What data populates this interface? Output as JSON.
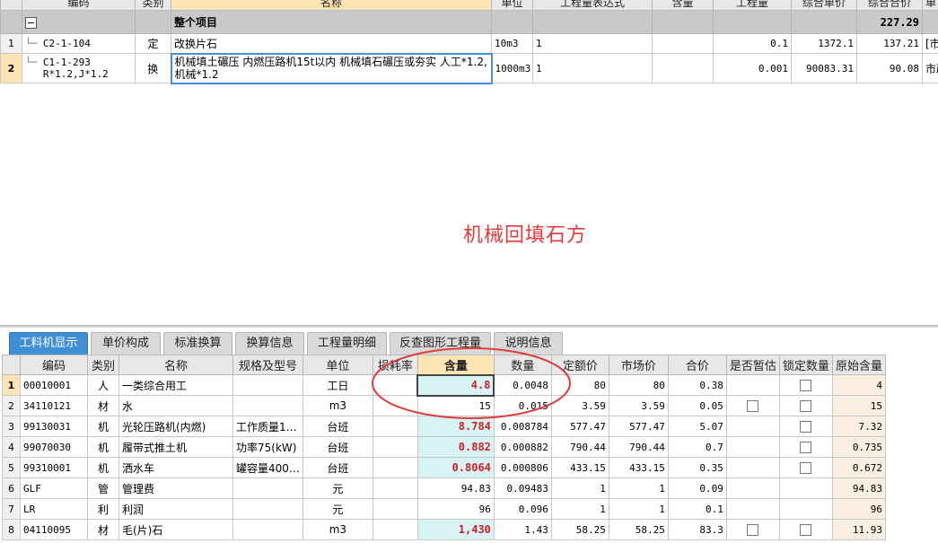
{
  "top_grid": {
    "columns": [
      "编码",
      "类别",
      "名称",
      "单位",
      "工程量表达式",
      "含量",
      "工程量",
      "综合单价",
      "综合合价",
      "单"
    ],
    "group_row": {
      "label": "整个项目",
      "total": "227.29"
    },
    "rows": [
      {
        "rn": "1",
        "code": "C2-1-104",
        "code2": "",
        "cat": "定",
        "name": "改换片石",
        "unit": "10m3",
        "expr": "1",
        "content": "",
        "qty": "0.1",
        "unit_price": "1372.1",
        "total": "137.21",
        "extra": "[市"
      },
      {
        "rn": "2",
        "code": "C1-1-293",
        "code2": "R*1.2,J*1.2",
        "cat": "换",
        "name": "机械填土碾压 内燃压路机15t以内  机械填石碾压或夯实 人工*1.2,机械*1.2",
        "unit": "1000m3",
        "expr": "1",
        "content": "",
        "qty": "0.001",
        "unit_price": "90083.31",
        "total": "90.08",
        "extra": "市政"
      }
    ]
  },
  "overlay_note": "机械回填石方",
  "tabs": [
    "工料机显示",
    "单价构成",
    "标准换算",
    "换算信息",
    "工程量明细",
    "反查图形工程量",
    "说明信息"
  ],
  "bottom_grid": {
    "columns": [
      "",
      "编码",
      "类别",
      "名称",
      "规格及型号",
      "单位",
      "损耗率",
      "含量",
      "数量",
      "定额价",
      "市场价",
      "合价",
      "是否暂估",
      "锁定数量",
      "原始含量"
    ],
    "rows": [
      {
        "rn": "1",
        "code": "00010001",
        "cat": "人",
        "name": "一类综合用工",
        "spec": "",
        "unit": "工日",
        "loss": "",
        "content": "4.8",
        "amount": "0.0048",
        "quota_price": "80",
        "market_price": "80",
        "total": "0.38",
        "provisional": false,
        "lock": true,
        "orig": "4"
      },
      {
        "rn": "2",
        "code": "34110121",
        "cat": "材",
        "name": "水",
        "spec": "",
        "unit": "m3",
        "loss": "",
        "content": "15",
        "amount": "0.015",
        "quota_price": "3.59",
        "market_price": "3.59",
        "total": "0.05",
        "provisional": true,
        "lock": true,
        "orig": "15"
      },
      {
        "rn": "3",
        "code": "99130031",
        "cat": "机",
        "name": "光轮压路机(内燃)",
        "spec": "工作质量1…",
        "unit": "台班",
        "loss": "",
        "content": "8.784",
        "amount": "0.008784",
        "quota_price": "577.47",
        "market_price": "577.47",
        "total": "5.07",
        "provisional": false,
        "lock": true,
        "orig": "7.32"
      },
      {
        "rn": "4",
        "code": "99070030",
        "cat": "机",
        "name": "履带式推土机",
        "spec": "功率75(kW)",
        "unit": "台班",
        "loss": "",
        "content": "0.882",
        "amount": "0.000882",
        "quota_price": "790.44",
        "market_price": "790.44",
        "total": "0.7",
        "provisional": false,
        "lock": true,
        "orig": "0.735"
      },
      {
        "rn": "5",
        "code": "99310001",
        "cat": "机",
        "name": "洒水车",
        "spec": "罐容量400…",
        "unit": "台班",
        "loss": "",
        "content": "0.8064",
        "amount": "0.000806",
        "quota_price": "433.15",
        "market_price": "433.15",
        "total": "0.35",
        "provisional": false,
        "lock": true,
        "orig": "0.672"
      },
      {
        "rn": "6",
        "code": "GLF",
        "cat": "管",
        "name": "管理费",
        "spec": "",
        "unit": "元",
        "loss": "",
        "content": "94.83",
        "amount": "0.09483",
        "quota_price": "1",
        "market_price": "1",
        "total": "0.09",
        "provisional": false,
        "lock": false,
        "orig": "94.83"
      },
      {
        "rn": "7",
        "code": "LR",
        "cat": "利",
        "name": "利润",
        "spec": "",
        "unit": "元",
        "loss": "",
        "content": "96",
        "amount": "0.096",
        "quota_price": "1",
        "market_price": "1",
        "total": "0.1",
        "provisional": false,
        "lock": false,
        "orig": "96"
      },
      {
        "rn": "8",
        "code": "04110095",
        "cat": "材",
        "name": "毛(片)石",
        "spec": "",
        "unit": "m3",
        "loss": "",
        "content": "1,430",
        "amount": "1.43",
        "quota_price": "58.25",
        "market_price": "58.25",
        "total": "83.3",
        "provisional": true,
        "lock": true,
        "orig": "11.93"
      }
    ]
  },
  "colors": {
    "accent_tab": "#3f8fd5",
    "highlight_header": "#fde4b2",
    "qty_cell": "#d8f3f6",
    "annotation": "#e03c3c"
  }
}
